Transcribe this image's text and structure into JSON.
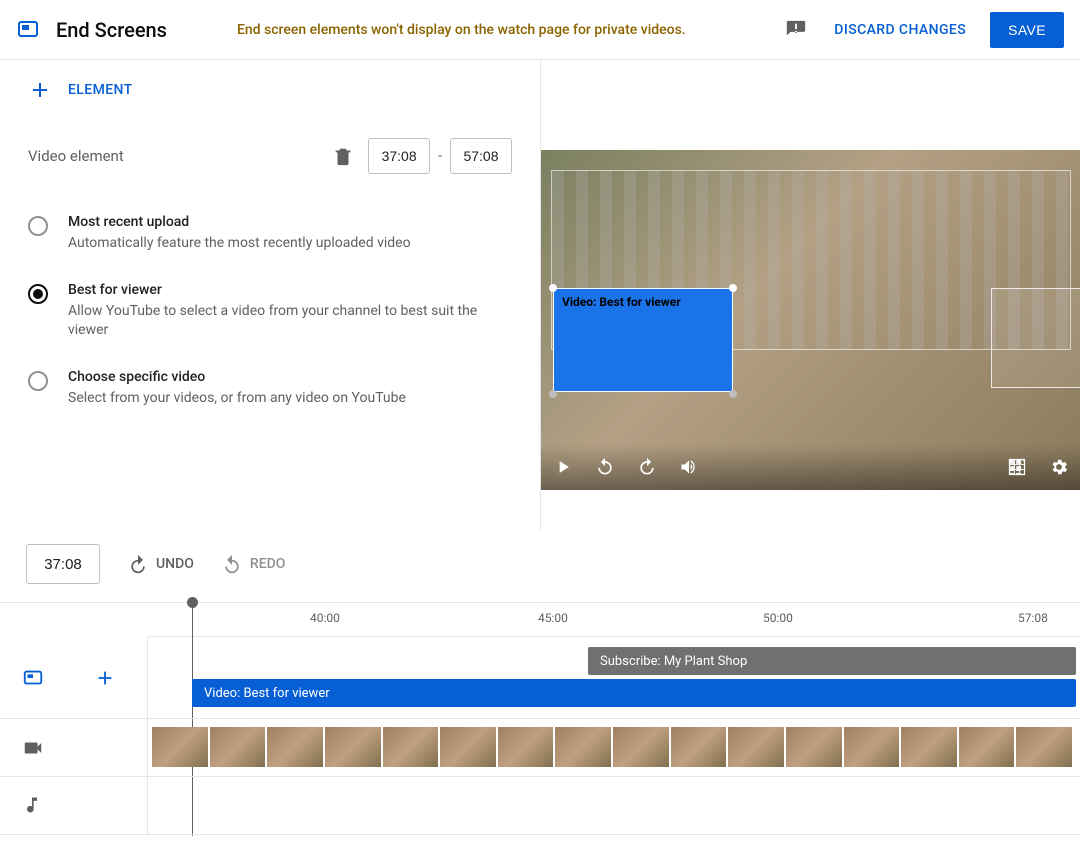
{
  "header": {
    "title": "End Screens",
    "warning": "End screen elements won't display on the watch page for private videos.",
    "discard_label": "DISCARD CHANGES",
    "save_label": "SAVE"
  },
  "left": {
    "add_element_label": "ELEMENT",
    "video_element_label": "Video element",
    "start_time": "37:08",
    "end_time": "57:08",
    "options": [
      {
        "label": "Most recent upload",
        "sub": "Automatically feature the most recently uploaded video"
      },
      {
        "label": "Best for viewer",
        "sub": "Allow YouTube to select a video from your channel to best suit the viewer"
      },
      {
        "label": "Choose specific video",
        "sub": "Select from your videos, or from any video on YouTube"
      }
    ]
  },
  "preview": {
    "overlay_label": "Video: Best for viewer"
  },
  "toolbar": {
    "current_time": "37:08",
    "undo_label": "UNDO",
    "redo_label": "REDO"
  },
  "timeline": {
    "ticks": [
      "40:00",
      "45:00",
      "50:00",
      "57:08"
    ],
    "subscribe_clip": "Subscribe: My Plant Shop",
    "video_clip": "Video: Best for viewer"
  }
}
